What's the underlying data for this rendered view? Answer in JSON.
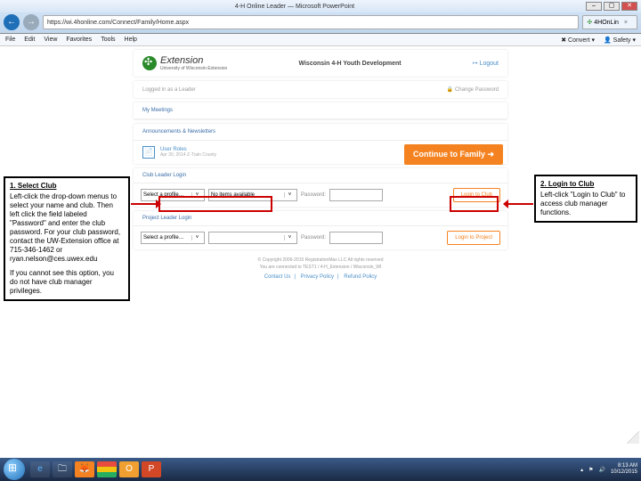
{
  "browser": {
    "title": "4-H Online Leader — Microsoft PowerPoint",
    "back": "←",
    "fwd": "→",
    "addr": "https://wi.4honline.com/Connect/Family/Home.aspx",
    "tab": "4HOnLin",
    "menu": {
      "file": "File",
      "edit": "Edit",
      "view": "View",
      "fav": "Favorites",
      "tools": "Tools",
      "help": "Help",
      "convert": "Convert",
      "safety": "Safety"
    }
  },
  "header": {
    "brand": "Extension",
    "brand_sub": "University of Wisconsin-Extension",
    "title": "Wisconsin 4-H Youth Development",
    "logout": "Logout"
  },
  "userbar": {
    "logged": "Logged in as a Leader",
    "change": "Change Password"
  },
  "sections": {
    "meetings": "My Meetings",
    "ann": "Announcements & Newsletters",
    "ann_item_title": "User Roles",
    "ann_item_date": "Apr 30, 2014 Z-Train County"
  },
  "continue": "Continue to Family",
  "club_login": {
    "hdr": "Club Leader Login",
    "profile": "Select a profile…",
    "items": "No items available",
    "pwd": "Password:",
    "btn": "Login to Club"
  },
  "proj_login": {
    "hdr": "Project Leader Login",
    "profile": "Select a profile…",
    "pwd": "Password:",
    "btn": "Login to Project"
  },
  "footer": {
    "copy": "© Copyright 2006-2015 RegistrationMax LLC All rights reserved",
    "sub": "You are connected to TEST1 / 4-H_Extension / Wisconsin_WI",
    "l1": "Contact Us",
    "l2": "Privacy Policy",
    "l3": "Refund Policy"
  },
  "callout_left": {
    "title": "1. Select Club",
    "body": "Left-click the drop-down menus to select your name and club. Then left click the field labeled \"Password\" and enter the club password. For your club password, contact the UW-Extension office at 715-346-1462 or ryan.nelson@ces.uwex.edu",
    "body2": "If you cannot see this option, you do not have club manager privileges."
  },
  "callout_right": {
    "title": "2. Login to Club",
    "body": "Left-click \"Login to Club\" to access club manager functions."
  },
  "taskbar": {
    "time": "8:13 AM",
    "date": "10/12/2015"
  }
}
